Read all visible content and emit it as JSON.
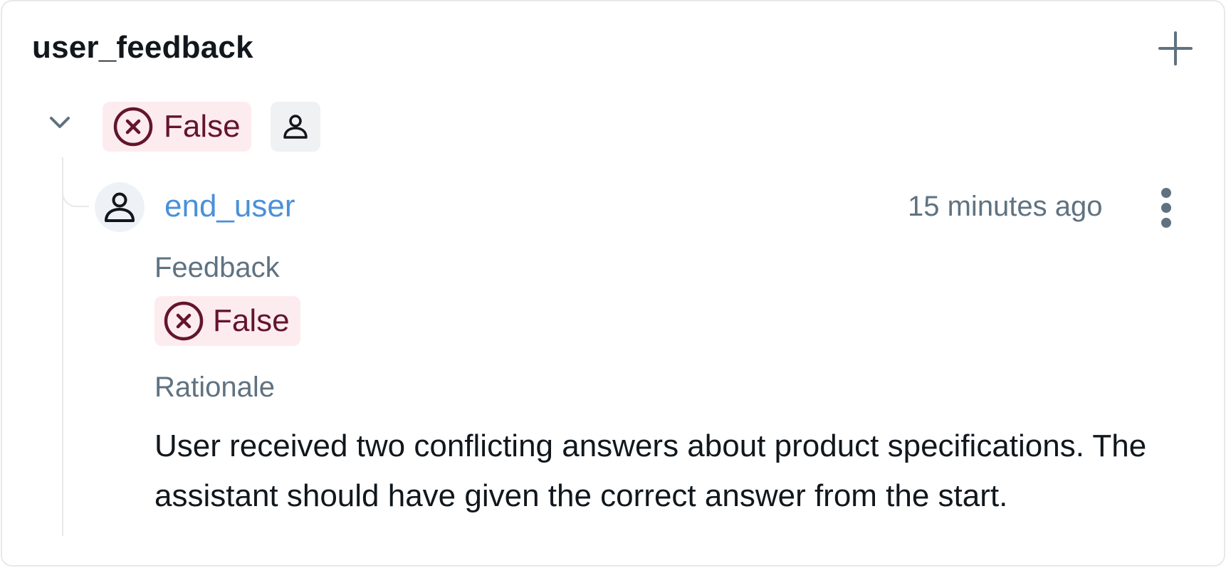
{
  "panel": {
    "title": "user_feedback",
    "add_icon": "plus-icon"
  },
  "assessment": {
    "collapse_icon": "chevron-down-icon",
    "value_label": "False",
    "value_icon": "x-circle-icon",
    "source_icon": "user-icon",
    "colors": {
      "pill_bg": "#fdecef",
      "pill_text": "#64152b"
    }
  },
  "entry": {
    "source_name": "end_user",
    "avatar_icon": "user-icon",
    "timestamp": "15 minutes ago",
    "menu_icon": "kebab-menu-icon",
    "feedback_label": "Feedback",
    "feedback_value": "False",
    "rationale_label": "Rationale",
    "rationale_text": "User received two conflicting answers about product specifications. The assistant should have given the correct answer from the start.",
    "colors": {
      "link": "#4a90d9",
      "muted": "#5f7281"
    }
  }
}
